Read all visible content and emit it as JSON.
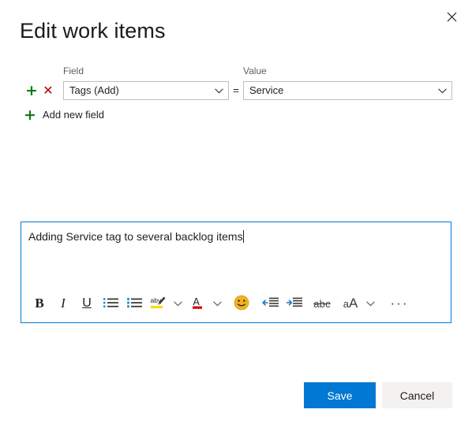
{
  "dialog": {
    "title": "Edit work items",
    "close_icon": "close-icon"
  },
  "rule_editor": {
    "column_headers": {
      "field": "Field",
      "value": "Value"
    },
    "operator": "=",
    "add_row_icon": "plus-icon",
    "remove_row_icon": "remove-x-icon",
    "row": {
      "field_value": "Tags (Add)",
      "value_value": "Service"
    },
    "add_new_field": {
      "icon": "plus-icon",
      "label": "Add new field"
    },
    "colors": {
      "add_green": "#107c10",
      "remove_red": "#c00000"
    }
  },
  "comment_editor": {
    "text": "Adding Service tag to several backlog items",
    "focus_border_color": "#0078d4",
    "toolbar": [
      {
        "name": "bold-icon",
        "label": "B"
      },
      {
        "name": "italic-icon",
        "label": "I"
      },
      {
        "name": "underline-icon",
        "label": "U"
      },
      {
        "name": "bulleted-list-icon",
        "label": ""
      },
      {
        "name": "numbered-list-icon",
        "label": ""
      },
      {
        "name": "highlight-color-icon",
        "label": "aby"
      },
      {
        "name": "highlight-color-chevron-down-icon",
        "label": ""
      },
      {
        "name": "font-color-icon",
        "label": "A"
      },
      {
        "name": "font-color-chevron-down-icon",
        "label": ""
      },
      {
        "name": "emoji-icon",
        "label": ""
      },
      {
        "name": "decrease-indent-icon",
        "label": ""
      },
      {
        "name": "increase-indent-icon",
        "label": ""
      },
      {
        "name": "strikethrough-icon",
        "label": "abc"
      },
      {
        "name": "font-size-icon",
        "label": "aA"
      },
      {
        "name": "font-size-chevron-down-icon",
        "label": ""
      },
      {
        "name": "more-options-icon",
        "label": "···"
      }
    ],
    "accent_colors": {
      "list_marker_blue": "#1a85c7",
      "highlight_yellow": "#ffd900",
      "font_color_red": "#d90000",
      "indent_arrow_blue": "#0f7ac4",
      "emoji_yellow": "#f0b323"
    }
  },
  "footer": {
    "save_label": "Save",
    "cancel_label": "Cancel",
    "save_bg": "#0078d4",
    "cancel_bg": "#f3f2f1"
  }
}
